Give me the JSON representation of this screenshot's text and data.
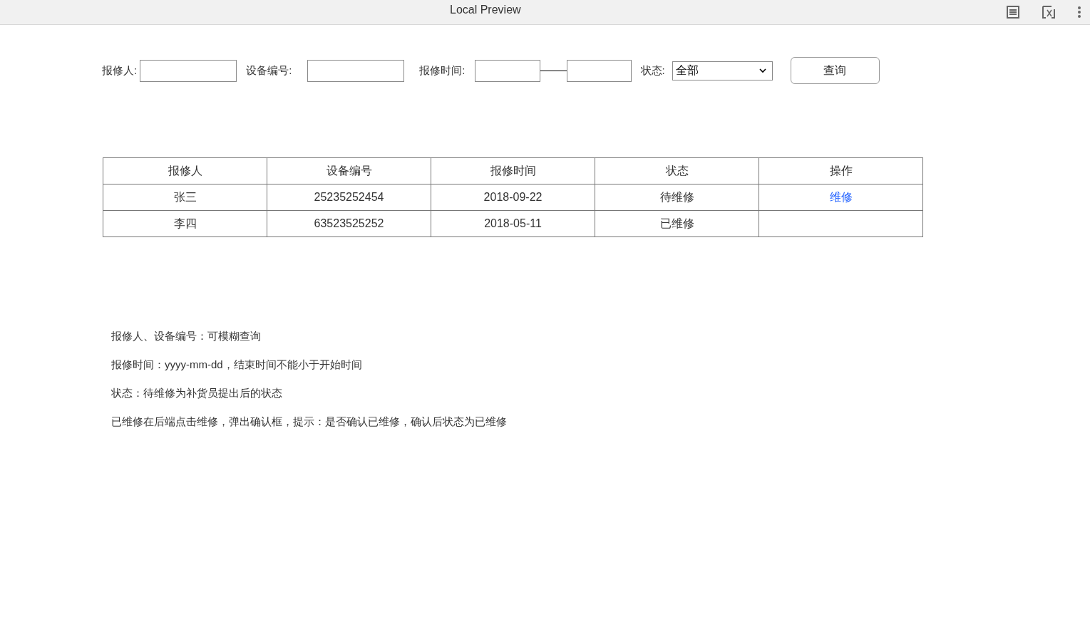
{
  "window": {
    "title": "Local Preview"
  },
  "filters": {
    "reporter_label": "报修人:",
    "device_label": "设备编号:",
    "time_label": "报修时间:",
    "status_label": "状态:",
    "status_value": "全部",
    "query_button": "查询"
  },
  "table": {
    "columns": [
      "报修人",
      "设备编号",
      "报修时间",
      "状态",
      "操作"
    ],
    "rows": [
      {
        "cells": [
          "张三",
          "25235252454",
          "2018-09-22",
          "待维修"
        ],
        "action": "维修"
      },
      {
        "cells": [
          "李四",
          "63523525252",
          "2018-05-11",
          "已维修"
        ]
      }
    ]
  },
  "notes": [
    "报修人、设备编号：可模糊查询",
    "报修时间：yyyy-mm-dd，结束时间不能小于开始时间",
    "状态：待维修为补货员提出后的状态",
    "已维修在后端点击维修，弹出确认框，提示：是否确认已维修，确认后状态为已维修"
  ]
}
